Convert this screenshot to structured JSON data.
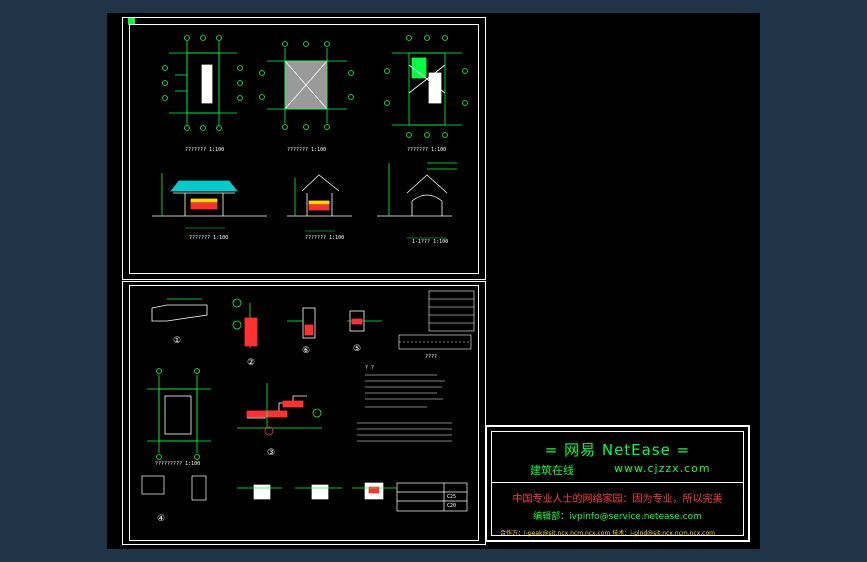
{
  "title_block": {
    "brand": "= 网易 NetEase =",
    "site_name": "建筑在线",
    "site_url": "www.cjzzx.com",
    "slogan": "中国专业人士的网络家园：因为专业，所以完美",
    "editor": "编辑部：ivpinfo@service.netease.com",
    "footer": "合作方：l-peak@sit.ncx.ncm.ncx.com 技术：i-plnd@sit.ncx.ncm.ncx.com"
  },
  "sheet1": {
    "captions": [
      "???????  1:100",
      "???????  1:100",
      "???????  1:100",
      "???????  1:100",
      "???????  1:100",
      "1-1???  1:100"
    ]
  },
  "sheet2": {
    "detail_markers": [
      "①",
      "②",
      "③",
      "④",
      "⑤",
      "⑥"
    ],
    "plan_caption": "?????????  1:100",
    "notes_heading": "? ?",
    "table_caption": "????",
    "legend_rows": [
      "C25",
      "C20"
    ]
  },
  "colors": {
    "background": "#1f3446",
    "sheet": "#000000",
    "frame": "#ffffff",
    "drawing_green": "#00ff40",
    "title_red": "#ff3a3a",
    "footer_yellow": "#ffd700"
  }
}
